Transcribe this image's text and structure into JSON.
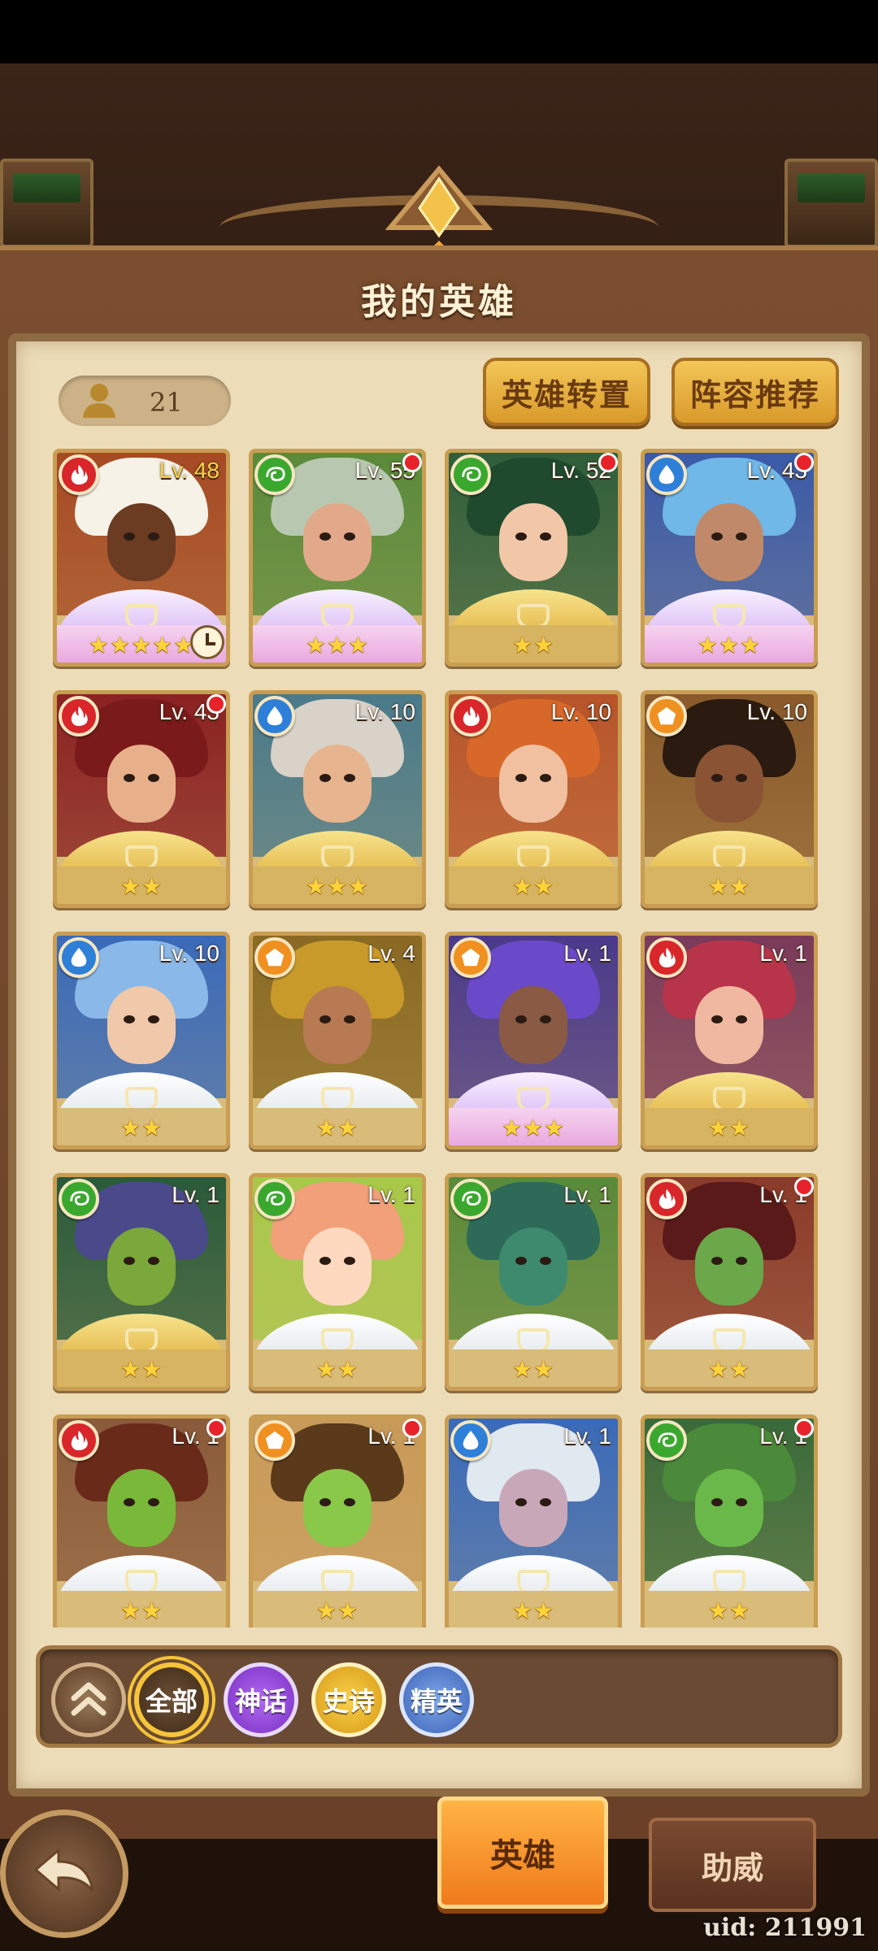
{
  "header": {
    "title": "我的英雄"
  },
  "toolbar": {
    "hero_count": "21",
    "transfer_label": "英雄转置",
    "recommend_label": "阵容推荐"
  },
  "colors": {
    "faction_fire": "#d8262a",
    "faction_nature": "#3aa82e",
    "faction_water": "#2e7fd8",
    "faction_earth": "#f09020",
    "notification": "#e8222a"
  },
  "heroes": [
    {
      "level": "Lv. 48",
      "faction": "fire",
      "rarity": "mythic",
      "stars": "★★★★★",
      "notify": false,
      "timer": true,
      "palette": [
        "#a64a24",
        "#f6f2e8",
        "#6b3b22"
      ]
    },
    {
      "level": "Lv. 55",
      "faction": "nature",
      "rarity": "mythic",
      "stars": "★★★",
      "notify": true,
      "timer": false,
      "palette": [
        "#5a8a3a",
        "#b8c8b0",
        "#e2a88a"
      ]
    },
    {
      "level": "Lv. 52",
      "faction": "nature",
      "rarity": "epic",
      "stars": "★★",
      "notify": true,
      "timer": false,
      "palette": [
        "#2f5e3a",
        "#1f4a2e",
        "#f2c7a8"
      ]
    },
    {
      "level": "Lv. 43",
      "faction": "water",
      "rarity": "mythic",
      "stars": "★★★",
      "notify": true,
      "timer": false,
      "palette": [
        "#3a5aa8",
        "#6fb8e8",
        "#c08a6a"
      ]
    },
    {
      "level": "Lv. 43",
      "faction": "fire",
      "rarity": "epic",
      "stars": "★★",
      "notify": true,
      "timer": false,
      "palette": [
        "#8a2222",
        "#7a1a1a",
        "#e8b08a"
      ]
    },
    {
      "level": "Lv. 10",
      "faction": "water",
      "rarity": "epic",
      "stars": "★★★",
      "notify": false,
      "timer": false,
      "palette": [
        "#4a7a8a",
        "#d8d2c8",
        "#e6b48e"
      ]
    },
    {
      "level": "Lv. 10",
      "faction": "fire",
      "rarity": "epic",
      "stars": "★★",
      "notify": false,
      "timer": false,
      "palette": [
        "#b8542a",
        "#d8682a",
        "#f0c0a0"
      ]
    },
    {
      "level": "Lv. 10",
      "faction": "earth",
      "rarity": "epic",
      "stars": "★★",
      "notify": false,
      "timer": false,
      "palette": [
        "#8a5a2a",
        "#2a1a10",
        "#8a5434"
      ]
    },
    {
      "level": "Lv. 10",
      "faction": "water",
      "rarity": "elite",
      "stars": "★★",
      "notify": false,
      "timer": false,
      "palette": [
        "#3a6ab8",
        "#8ab8e8",
        "#f0c8aa"
      ]
    },
    {
      "level": "Lv. 4",
      "faction": "earth",
      "rarity": "elite",
      "stars": "★★",
      "notify": false,
      "timer": false,
      "palette": [
        "#8a6a22",
        "#c89a2a",
        "#b87a52"
      ]
    },
    {
      "level": "Lv. 1",
      "faction": "earth",
      "rarity": "mythic",
      "stars": "★★★",
      "notify": false,
      "timer": false,
      "palette": [
        "#4a3a8a",
        "#6a4ac8",
        "#8a5a44"
      ]
    },
    {
      "level": "Lv. 1",
      "faction": "fire",
      "rarity": "epic",
      "stars": "★★",
      "notify": false,
      "timer": false,
      "palette": [
        "#7a3a5a",
        "#b8344a",
        "#f0b8a0"
      ]
    },
    {
      "level": "Lv. 1",
      "faction": "nature",
      "rarity": "epic",
      "stars": "★★",
      "notify": false,
      "timer": false,
      "palette": [
        "#2a5a3a",
        "#4a4a8a",
        "#7aa83a"
      ]
    },
    {
      "level": "Lv. 1",
      "faction": "nature",
      "rarity": "elite",
      "stars": "★★",
      "notify": false,
      "timer": false,
      "palette": [
        "#a8c84a",
        "#f2a07a",
        "#ffd8c0"
      ]
    },
    {
      "level": "Lv. 1",
      "faction": "nature",
      "rarity": "elite",
      "stars": "★★",
      "notify": false,
      "timer": false,
      "palette": [
        "#5a8a3a",
        "#2e6a58",
        "#3e8a6e"
      ]
    },
    {
      "level": "Lv. 1",
      "faction": "fire",
      "rarity": "elite",
      "stars": "★★",
      "notify": true,
      "timer": false,
      "palette": [
        "#8a3a2a",
        "#5a1a1a",
        "#6aa84a"
      ]
    },
    {
      "level": "Lv. 1",
      "faction": "fire",
      "rarity": "elite",
      "stars": "★★",
      "notify": true,
      "timer": false,
      "palette": [
        "#8a5a3a",
        "#6a2a1a",
        "#7ab83a"
      ]
    },
    {
      "level": "Lv. 1",
      "faction": "earth",
      "rarity": "elite",
      "stars": "★★",
      "notify": true,
      "timer": false,
      "palette": [
        "#c89a5a",
        "#5a3a1a",
        "#8ac84a"
      ]
    },
    {
      "level": "Lv. 1",
      "faction": "water",
      "rarity": "elite",
      "stars": "★★",
      "notify": false,
      "timer": false,
      "palette": [
        "#3a6ab8",
        "#e0e8f0",
        "#c8a8b8"
      ]
    },
    {
      "level": "Lv. 1",
      "faction": "nature",
      "rarity": "elite",
      "stars": "★★",
      "notify": true,
      "timer": false,
      "palette": [
        "#3a6a3a",
        "#4a8a3a",
        "#6ab84a"
      ]
    }
  ],
  "filters": {
    "all": "全部",
    "mythic": "神话",
    "epic": "史诗",
    "elite": "精英"
  },
  "bottom_nav": {
    "heroes": "英雄",
    "support": "助威"
  },
  "uid_text": "uid: 211991"
}
